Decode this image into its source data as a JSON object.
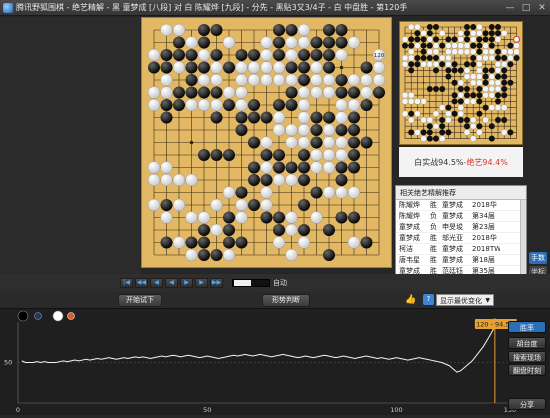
{
  "app": {
    "title": "腾讯野狐围棋 - 绝艺精解 - 黑 童梦成 [八段] 对 白 陈耀烨 [九段] - 分先 - 黑贴3又3/4子 - 白 中盘胜 - 第120手",
    "window_buttons": [
      "—",
      "□",
      "✕"
    ]
  },
  "board": {
    "move_label": "120",
    "black": [
      [
        4,
        0
      ],
      [
        5,
        0
      ],
      [
        10,
        0
      ],
      [
        11,
        0
      ],
      [
        14,
        0
      ],
      [
        15,
        0
      ],
      [
        2,
        1
      ],
      [
        4,
        1
      ],
      [
        10,
        1
      ],
      [
        13,
        1
      ],
      [
        14,
        1
      ],
      [
        15,
        1
      ],
      [
        1,
        2
      ],
      [
        2,
        2
      ],
      [
        3,
        2
      ],
      [
        5,
        2
      ],
      [
        7,
        2
      ],
      [
        8,
        2
      ],
      [
        10,
        2
      ],
      [
        12,
        2
      ],
      [
        13,
        2
      ],
      [
        14,
        2
      ],
      [
        0,
        3
      ],
      [
        1,
        3
      ],
      [
        3,
        3
      ],
      [
        4,
        3
      ],
      [
        6,
        3
      ],
      [
        11,
        3
      ],
      [
        12,
        3
      ],
      [
        14,
        3
      ],
      [
        17,
        3
      ],
      [
        3,
        4
      ],
      [
        12,
        4
      ],
      [
        15,
        4
      ],
      [
        2,
        5
      ],
      [
        3,
        5
      ],
      [
        4,
        5
      ],
      [
        5,
        5
      ],
      [
        11,
        5
      ],
      [
        15,
        5
      ],
      [
        16,
        5
      ],
      [
        18,
        5
      ],
      [
        1,
        6
      ],
      [
        2,
        6
      ],
      [
        6,
        6
      ],
      [
        8,
        6
      ],
      [
        10,
        6
      ],
      [
        11,
        6
      ],
      [
        17,
        6
      ],
      [
        1,
        7
      ],
      [
        5,
        7
      ],
      [
        7,
        7
      ],
      [
        8,
        7
      ],
      [
        9,
        7
      ],
      [
        13,
        7
      ],
      [
        14,
        7
      ],
      [
        16,
        7
      ],
      [
        7,
        8
      ],
      [
        13,
        8
      ],
      [
        15,
        8
      ],
      [
        16,
        8
      ],
      [
        8,
        9
      ],
      [
        13,
        9
      ],
      [
        16,
        9
      ],
      [
        17,
        9
      ],
      [
        4,
        10
      ],
      [
        5,
        10
      ],
      [
        6,
        10
      ],
      [
        9,
        10
      ],
      [
        10,
        10
      ],
      [
        12,
        10
      ],
      [
        16,
        10
      ],
      [
        8,
        11
      ],
      [
        10,
        11
      ],
      [
        11,
        11
      ],
      [
        12,
        11
      ],
      [
        15,
        11
      ],
      [
        16,
        11
      ],
      [
        8,
        12
      ],
      [
        9,
        12
      ],
      [
        12,
        12
      ],
      [
        15,
        12
      ],
      [
        7,
        13
      ],
      [
        13,
        13
      ],
      [
        1,
        14
      ],
      [
        8,
        14
      ],
      [
        12,
        14
      ],
      [
        6,
        15
      ],
      [
        9,
        15
      ],
      [
        10,
        15
      ],
      [
        15,
        15
      ],
      [
        16,
        15
      ],
      [
        4,
        16
      ],
      [
        6,
        16
      ],
      [
        10,
        16
      ],
      [
        12,
        16
      ],
      [
        14,
        16
      ],
      [
        1,
        17
      ],
      [
        3,
        17
      ],
      [
        4,
        17
      ],
      [
        6,
        17
      ],
      [
        7,
        17
      ],
      [
        17,
        17
      ],
      [
        4,
        18
      ],
      [
        5,
        18
      ],
      [
        14,
        18
      ]
    ],
    "white": [
      [
        1,
        0
      ],
      [
        2,
        0
      ],
      [
        12,
        0
      ],
      [
        3,
        1
      ],
      [
        6,
        1
      ],
      [
        9,
        1
      ],
      [
        11,
        1
      ],
      [
        12,
        1
      ],
      [
        16,
        1
      ],
      [
        0,
        2
      ],
      [
        4,
        2
      ],
      [
        9,
        2
      ],
      [
        11,
        2
      ],
      [
        15,
        2
      ],
      [
        2,
        3
      ],
      [
        5,
        3
      ],
      [
        7,
        3
      ],
      [
        8,
        3
      ],
      [
        9,
        3
      ],
      [
        10,
        3
      ],
      [
        13,
        3
      ],
      [
        18,
        3
      ],
      [
        1,
        4
      ],
      [
        4,
        4
      ],
      [
        5,
        4
      ],
      [
        7,
        4
      ],
      [
        8,
        4
      ],
      [
        9,
        4
      ],
      [
        10,
        4
      ],
      [
        11,
        4
      ],
      [
        13,
        4
      ],
      [
        14,
        4
      ],
      [
        16,
        4
      ],
      [
        17,
        4
      ],
      [
        18,
        4
      ],
      [
        0,
        5
      ],
      [
        1,
        5
      ],
      [
        6,
        5
      ],
      [
        7,
        5
      ],
      [
        12,
        5
      ],
      [
        13,
        5
      ],
      [
        14,
        5
      ],
      [
        17,
        5
      ],
      [
        0,
        6
      ],
      [
        3,
        6
      ],
      [
        4,
        6
      ],
      [
        5,
        6
      ],
      [
        7,
        6
      ],
      [
        12,
        6
      ],
      [
        16,
        6
      ],
      [
        15,
        6
      ],
      [
        12,
        7
      ],
      [
        15,
        7
      ],
      [
        10,
        7
      ],
      [
        12,
        8
      ],
      [
        14,
        8
      ],
      [
        9,
        9
      ],
      [
        11,
        9
      ],
      [
        12,
        9
      ],
      [
        14,
        9
      ],
      [
        15,
        9
      ],
      [
        11,
        8
      ],
      [
        10,
        8
      ],
      [
        13,
        10
      ],
      [
        14,
        10
      ],
      [
        15,
        10
      ],
      [
        0,
        11
      ],
      [
        1,
        11
      ],
      [
        9,
        11
      ],
      [
        13,
        11
      ],
      [
        14,
        11
      ],
      [
        0,
        12
      ],
      [
        1,
        12
      ],
      [
        2,
        12
      ],
      [
        3,
        12
      ],
      [
        10,
        12
      ],
      [
        11,
        12
      ],
      [
        6,
        13
      ],
      [
        9,
        13
      ],
      [
        14,
        13
      ],
      [
        15,
        13
      ],
      [
        16,
        13
      ],
      [
        0,
        14
      ],
      [
        2,
        14
      ],
      [
        5,
        14
      ],
      [
        7,
        14
      ],
      [
        9,
        14
      ],
      [
        3,
        15
      ],
      [
        4,
        15
      ],
      [
        7,
        15
      ],
      [
        11,
        15
      ],
      [
        13,
        15
      ],
      [
        1,
        15
      ],
      [
        5,
        16
      ],
      [
        11,
        16
      ],
      [
        2,
        17
      ],
      [
        10,
        17
      ],
      [
        12,
        17
      ],
      [
        16,
        17
      ],
      [
        3,
        18
      ],
      [
        11,
        18
      ],
      [
        6,
        18
      ]
    ],
    "last_move": [
      18,
      2
    ]
  },
  "winrate": {
    "prefix": "白实战94.5%",
    "sep": " - ",
    "suffix": "绝艺94.4%"
  },
  "list": {
    "header": "相关绝艺精解推荐",
    "rows": [
      {
        "a": "陈耀烨",
        "r": "胜",
        "b": "童梦成",
        "e": "2018华"
      },
      {
        "a": "陈耀烨",
        "r": "负",
        "b": "童梦成",
        "e": "第34届"
      },
      {
        "a": "童梦成",
        "r": "负",
        "b": "申旻埈",
        "e": "第23届"
      },
      {
        "a": "童梦成",
        "r": "胜",
        "b": "邬光亚",
        "e": "2018华"
      },
      {
        "a": "柯洁",
        "r": "胜",
        "b": "童梦成",
        "e": "2018TW"
      },
      {
        "a": "唐韦星",
        "r": "胜",
        "b": "童梦成",
        "e": "第18届"
      },
      {
        "a": "童梦成",
        "r": "胜",
        "b": "范廷钰",
        "e": "第35届"
      },
      {
        "a": "杨鼎新",
        "r": "负",
        "b": "童梦成",
        "e": "第35届"
      }
    ]
  },
  "side_buttons": [
    "手数",
    "坐标"
  ],
  "controls": {
    "nav": [
      "|◀",
      "◀◀",
      "◀",
      "◀",
      "▶",
      "▶",
      "▶▶",
      "▶|"
    ],
    "slider_value": "120",
    "auto": "自动"
  },
  "actions": {
    "trial": "开始试下",
    "judge": "形势判断",
    "help": "?",
    "variant": "显示最优变化",
    "thumb": "👍"
  },
  "graph": {
    "tooltip": "120 - 94.5%",
    "buttons": [
      "胜率",
      "胡台度",
      "搜索现场",
      "翻盘时刻",
      "分享"
    ],
    "y_label": "50",
    "x_ticks": [
      "0",
      "50",
      "100",
      "130"
    ],
    "winrate_series": [
      52,
      50,
      50,
      50,
      51,
      50,
      51,
      50,
      50,
      50,
      51,
      52,
      51,
      52,
      53,
      52,
      53,
      54,
      53,
      54,
      55,
      54,
      55,
      56,
      55,
      54,
      55,
      56,
      55,
      56,
      57,
      56,
      57,
      56,
      55,
      56,
      57,
      58,
      57,
      58,
      59,
      58,
      57,
      58,
      59,
      58,
      57,
      56,
      57,
      58,
      57,
      56,
      55,
      56,
      57,
      58,
      59,
      58,
      59,
      60,
      59,
      58,
      59,
      60,
      59,
      58,
      57,
      58,
      59,
      60,
      59,
      58,
      57,
      56,
      57,
      58,
      57,
      56,
      57,
      58,
      59,
      58,
      57,
      56,
      57,
      58,
      57,
      56,
      55,
      56,
      57,
      58,
      57,
      56,
      55,
      56,
      55,
      54,
      55,
      56,
      55,
      54,
      53,
      54,
      55,
      56,
      55,
      54,
      53,
      52,
      51,
      50,
      48,
      46,
      42,
      38,
      40,
      44,
      48,
      52,
      58,
      64,
      70,
      78,
      86,
      94.5
    ]
  }
}
